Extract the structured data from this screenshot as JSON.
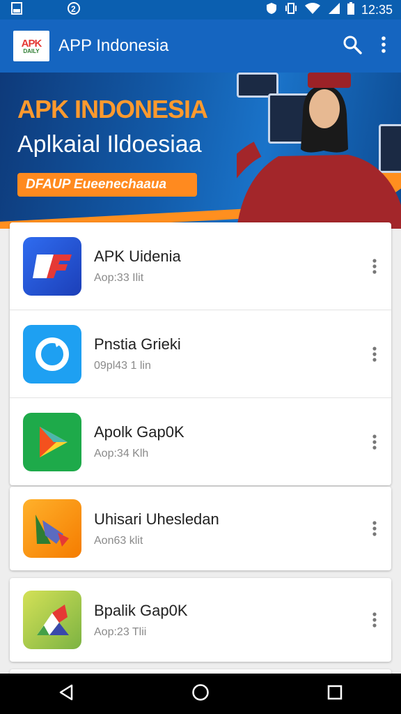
{
  "status": {
    "time": "12:35"
  },
  "appbar": {
    "title": "APP Indonesia",
    "logo_line1": "APK",
    "logo_line2": "DAILY"
  },
  "banner": {
    "title": "APK INDONESIA",
    "subtitle": "Aplkaial Ildoesiaa",
    "button": "DFAUP Eueenechaaua"
  },
  "apps": [
    {
      "title": "APK Uidenia",
      "subtitle": "Aop:33 Ilit",
      "icon": "bf-logo-icon",
      "color": "#1e4fd6"
    },
    {
      "title": "Pnstia Grieki",
      "subtitle": "09pl43 1 lin",
      "icon": "ring-logo-icon",
      "color": "#1ea0f2"
    },
    {
      "title": "Apolk Gap0K",
      "subtitle": "Aop:34 Klh",
      "icon": "play-triangle-icon",
      "color": "#1eaa4a"
    },
    {
      "title": "Uhisari Uhesledan",
      "subtitle": "Aon63 klit",
      "icon": "maps-pin-icon",
      "color": "#f7a11a"
    },
    {
      "title": "Bpalik Gap0K",
      "subtitle": "Aop:23 Tlii",
      "icon": "maps-arrow-icon",
      "color": "#8bc34a"
    }
  ],
  "colors": {
    "primary": "#1565c0",
    "status": "#0b5fb0",
    "accent": "#ff8a1f"
  }
}
